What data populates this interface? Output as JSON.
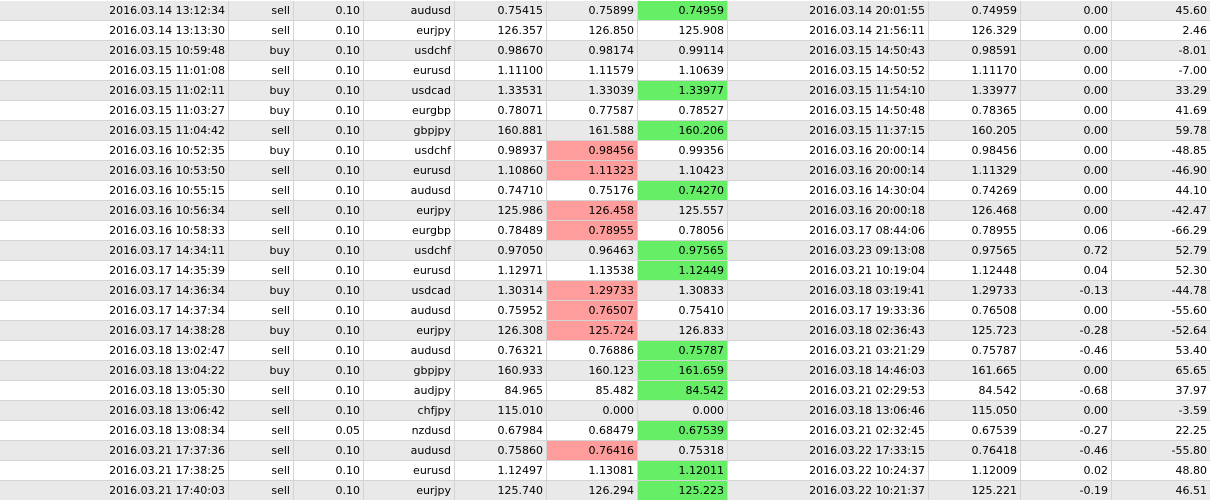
{
  "colors": {
    "row_even": "#ffffff",
    "row_odd": "#e9e9e9",
    "stop_loss_hit": "#ff9c9c",
    "take_profit_hit": "#66ee66"
  },
  "trades": {
    "rows": [
      {
        "open_time": "2016.03.14 13:12:34",
        "type": "sell",
        "size": "0.10",
        "symbol": "audusd",
        "open_price": "0.75415",
        "stop_loss": "0.75899",
        "take_profit": "0.74959",
        "close_time": "2016.03.14 20:01:55",
        "close_price": "0.74959",
        "swap": "0.00",
        "profit": "45.60",
        "hit": "tp",
        "shade": "odd"
      },
      {
        "open_time": "2016.03.14 13:13:30",
        "type": "sell",
        "size": "0.10",
        "symbol": "eurjpy",
        "open_price": "126.357",
        "stop_loss": "126.850",
        "take_profit": "125.908",
        "close_time": "2016.03.14 21:56:11",
        "close_price": "126.329",
        "swap": "0.00",
        "profit": "2.46",
        "hit": "",
        "shade": "even"
      },
      {
        "open_time": "2016.03.15 10:59:48",
        "type": "buy",
        "size": "0.10",
        "symbol": "usdchf",
        "open_price": "0.98670",
        "stop_loss": "0.98174",
        "take_profit": "0.99114",
        "close_time": "2016.03.15 14:50:43",
        "close_price": "0.98591",
        "swap": "0.00",
        "profit": "-8.01",
        "hit": "",
        "shade": "odd"
      },
      {
        "open_time": "2016.03.15 11:01:08",
        "type": "sell",
        "size": "0.10",
        "symbol": "eurusd",
        "open_price": "1.11100",
        "stop_loss": "1.11579",
        "take_profit": "1.10639",
        "close_time": "2016.03.15 14:50:52",
        "close_price": "1.11170",
        "swap": "0.00",
        "profit": "-7.00",
        "hit": "",
        "shade": "even"
      },
      {
        "open_time": "2016.03.15 11:02:11",
        "type": "buy",
        "size": "0.10",
        "symbol": "usdcad",
        "open_price": "1.33531",
        "stop_loss": "1.33039",
        "take_profit": "1.33977",
        "close_time": "2016.03.15 11:54:10",
        "close_price": "1.33977",
        "swap": "0.00",
        "profit": "33.29",
        "hit": "tp",
        "shade": "odd"
      },
      {
        "open_time": "2016.03.15 11:03:27",
        "type": "buy",
        "size": "0.10",
        "symbol": "eurgbp",
        "open_price": "0.78071",
        "stop_loss": "0.77587",
        "take_profit": "0.78527",
        "close_time": "2016.03.15 14:50:48",
        "close_price": "0.78365",
        "swap": "0.00",
        "profit": "41.69",
        "hit": "",
        "shade": "even"
      },
      {
        "open_time": "2016.03.15 11:04:42",
        "type": "sell",
        "size": "0.10",
        "symbol": "gbpjpy",
        "open_price": "160.881",
        "stop_loss": "161.588",
        "take_profit": "160.206",
        "close_time": "2016.03.15 11:37:15",
        "close_price": "160.205",
        "swap": "0.00",
        "profit": "59.78",
        "hit": "tp",
        "shade": "odd"
      },
      {
        "open_time": "2016.03.16 10:52:35",
        "type": "buy",
        "size": "0.10",
        "symbol": "usdchf",
        "open_price": "0.98937",
        "stop_loss": "0.98456",
        "take_profit": "0.99356",
        "close_time": "2016.03.16 20:00:14",
        "close_price": "0.98456",
        "swap": "0.00",
        "profit": "-48.85",
        "hit": "sl",
        "shade": "even"
      },
      {
        "open_time": "2016.03.16 10:53:50",
        "type": "sell",
        "size": "0.10",
        "symbol": "eurusd",
        "open_price": "1.10860",
        "stop_loss": "1.11323",
        "take_profit": "1.10423",
        "close_time": "2016.03.16 20:00:14",
        "close_price": "1.11329",
        "swap": "0.00",
        "profit": "-46.90",
        "hit": "sl",
        "shade": "odd"
      },
      {
        "open_time": "2016.03.16 10:55:15",
        "type": "sell",
        "size": "0.10",
        "symbol": "audusd",
        "open_price": "0.74710",
        "stop_loss": "0.75176",
        "take_profit": "0.74270",
        "close_time": "2016.03.16 14:30:04",
        "close_price": "0.74269",
        "swap": "0.00",
        "profit": "44.10",
        "hit": "tp",
        "shade": "even"
      },
      {
        "open_time": "2016.03.16 10:56:34",
        "type": "sell",
        "size": "0.10",
        "symbol": "eurjpy",
        "open_price": "125.986",
        "stop_loss": "126.458",
        "take_profit": "125.557",
        "close_time": "2016.03.16 20:00:18",
        "close_price": "126.468",
        "swap": "0.00",
        "profit": "-42.47",
        "hit": "sl",
        "shade": "odd"
      },
      {
        "open_time": "2016.03.16 10:58:33",
        "type": "sell",
        "size": "0.10",
        "symbol": "eurgbp",
        "open_price": "0.78489",
        "stop_loss": "0.78955",
        "take_profit": "0.78056",
        "close_time": "2016.03.17 08:44:06",
        "close_price": "0.78955",
        "swap": "0.06",
        "profit": "-66.29",
        "hit": "sl",
        "shade": "even"
      },
      {
        "open_time": "2016.03.17 14:34:11",
        "type": "buy",
        "size": "0.10",
        "symbol": "usdchf",
        "open_price": "0.97050",
        "stop_loss": "0.96463",
        "take_profit": "0.97565",
        "close_time": "2016.03.23 09:13:08",
        "close_price": "0.97565",
        "swap": "0.72",
        "profit": "52.79",
        "hit": "tp",
        "shade": "odd"
      },
      {
        "open_time": "2016.03.17 14:35:39",
        "type": "sell",
        "size": "0.10",
        "symbol": "eurusd",
        "open_price": "1.12971",
        "stop_loss": "1.13538",
        "take_profit": "1.12449",
        "close_time": "2016.03.21 10:19:04",
        "close_price": "1.12448",
        "swap": "0.04",
        "profit": "52.30",
        "hit": "tp",
        "shade": "even"
      },
      {
        "open_time": "2016.03.17 14:36:34",
        "type": "buy",
        "size": "0.10",
        "symbol": "usdcad",
        "open_price": "1.30314",
        "stop_loss": "1.29733",
        "take_profit": "1.30833",
        "close_time": "2016.03.18 03:19:41",
        "close_price": "1.29733",
        "swap": "-0.13",
        "profit": "-44.78",
        "hit": "sl",
        "shade": "odd"
      },
      {
        "open_time": "2016.03.17 14:37:34",
        "type": "sell",
        "size": "0.10",
        "symbol": "audusd",
        "open_price": "0.75952",
        "stop_loss": "0.76507",
        "take_profit": "0.75410",
        "close_time": "2016.03.17 19:33:36",
        "close_price": "0.76508",
        "swap": "0.00",
        "profit": "-55.60",
        "hit": "sl",
        "shade": "even"
      },
      {
        "open_time": "2016.03.17 14:38:28",
        "type": "buy",
        "size": "0.10",
        "symbol": "eurjpy",
        "open_price": "126.308",
        "stop_loss": "125.724",
        "take_profit": "126.833",
        "close_time": "2016.03.18 02:36:43",
        "close_price": "125.723",
        "swap": "-0.28",
        "profit": "-52.64",
        "hit": "sl",
        "shade": "odd"
      },
      {
        "open_time": "2016.03.18 13:02:47",
        "type": "sell",
        "size": "0.10",
        "symbol": "audusd",
        "open_price": "0.76321",
        "stop_loss": "0.76886",
        "take_profit": "0.75787",
        "close_time": "2016.03.21 03:21:29",
        "close_price": "0.75787",
        "swap": "-0.46",
        "profit": "53.40",
        "hit": "tp",
        "shade": "even"
      },
      {
        "open_time": "2016.03.18 13:04:22",
        "type": "buy",
        "size": "0.10",
        "symbol": "gbpjpy",
        "open_price": "160.933",
        "stop_loss": "160.123",
        "take_profit": "161.659",
        "close_time": "2016.03.18 14:46:03",
        "close_price": "161.665",
        "swap": "0.00",
        "profit": "65.65",
        "hit": "tp",
        "shade": "odd"
      },
      {
        "open_time": "2016.03.18 13:05:30",
        "type": "sell",
        "size": "0.10",
        "symbol": "audjpy",
        "open_price": "84.965",
        "stop_loss": "85.482",
        "take_profit": "84.542",
        "close_time": "2016.03.21 02:29:53",
        "close_price": "84.542",
        "swap": "-0.68",
        "profit": "37.97",
        "hit": "tp",
        "shade": "even"
      },
      {
        "open_time": "2016.03.18 13:06:42",
        "type": "sell",
        "size": "0.10",
        "symbol": "chfjpy",
        "open_price": "115.010",
        "stop_loss": "0.000",
        "take_profit": "0.000",
        "close_time": "2016.03.18 13:06:46",
        "close_price": "115.050",
        "swap": "0.00",
        "profit": "-3.59",
        "hit": "",
        "shade": "odd"
      },
      {
        "open_time": "2016.03.18 13:08:34",
        "type": "sell",
        "size": "0.05",
        "symbol": "nzdusd",
        "open_price": "0.67984",
        "stop_loss": "0.68479",
        "take_profit": "0.67539",
        "close_time": "2016.03.21 02:32:45",
        "close_price": "0.67539",
        "swap": "-0.27",
        "profit": "22.25",
        "hit": "tp",
        "shade": "even"
      },
      {
        "open_time": "2016.03.21 17:37:36",
        "type": "sell",
        "size": "0.10",
        "symbol": "audusd",
        "open_price": "0.75860",
        "stop_loss": "0.76416",
        "take_profit": "0.75318",
        "close_time": "2016.03.22 17:33:15",
        "close_price": "0.76418",
        "swap": "-0.46",
        "profit": "-55.80",
        "hit": "sl",
        "shade": "odd"
      },
      {
        "open_time": "2016.03.21 17:38:25",
        "type": "sell",
        "size": "0.10",
        "symbol": "eurusd",
        "open_price": "1.12497",
        "stop_loss": "1.13081",
        "take_profit": "1.12011",
        "close_time": "2016.03.22 10:24:37",
        "close_price": "1.12009",
        "swap": "0.02",
        "profit": "48.80",
        "hit": "tp",
        "shade": "even"
      },
      {
        "open_time": "2016.03.21 17:40:03",
        "type": "sell",
        "size": "0.10",
        "symbol": "eurjpy",
        "open_price": "125.740",
        "stop_loss": "126.294",
        "take_profit": "125.223",
        "close_time": "2016.03.22 10:21:37",
        "close_price": "125.221",
        "swap": "-0.19",
        "profit": "46.51",
        "hit": "tp",
        "shade": "odd"
      }
    ]
  }
}
